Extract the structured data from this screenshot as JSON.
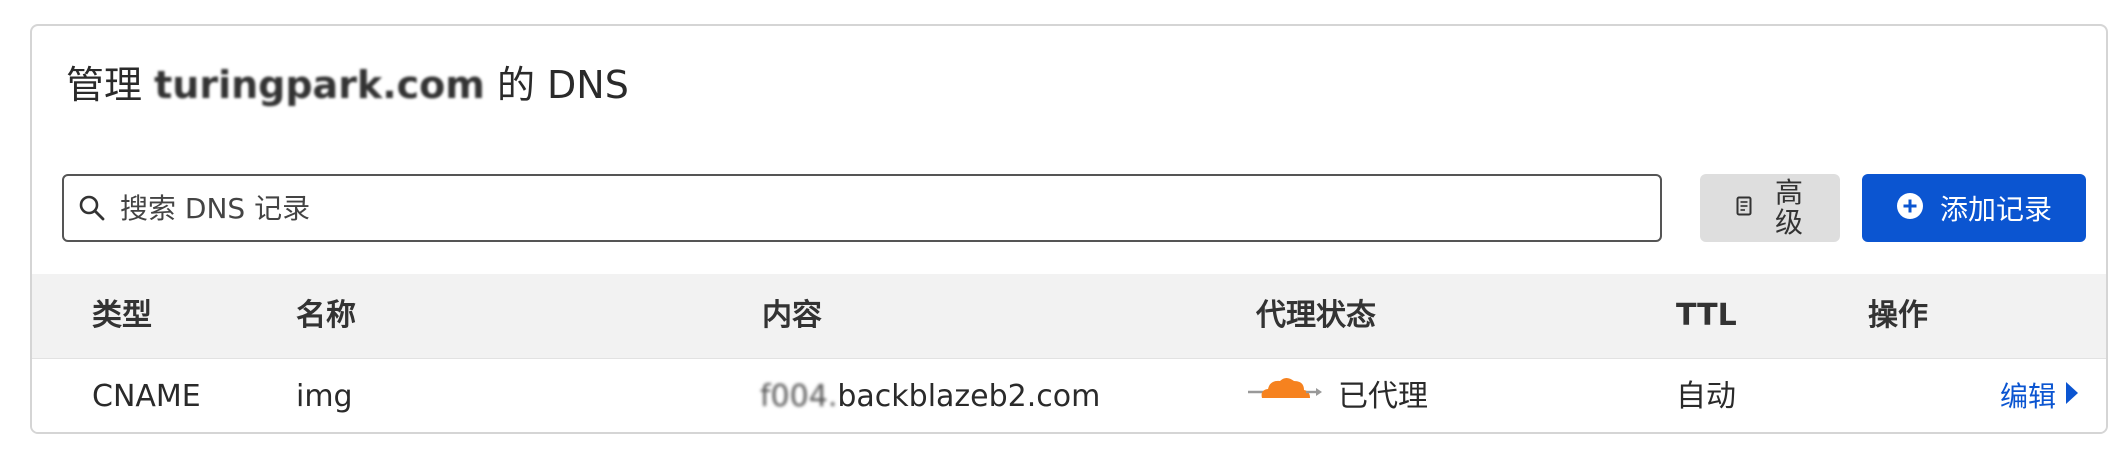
{
  "header": {
    "title_prefix": "管理",
    "domain": "turingpark.com",
    "title_suffix": "的 DNS"
  },
  "search": {
    "placeholder": "搜索 DNS 记录",
    "icon": "search-icon"
  },
  "buttons": {
    "advanced_label": "高级",
    "advanced_icon": "document-icon",
    "add_label": "添加记录",
    "add_icon": "plus-circle-icon"
  },
  "table": {
    "columns": [
      "类型",
      "名称",
      "内容",
      "代理状态",
      "TTL",
      "操作"
    ],
    "rows": [
      {
        "type": "CNAME",
        "name": "img",
        "content_hidden": "f004.",
        "content": "backblazeb2.com",
        "proxy_status": "已代理",
        "proxy_icon": "cloud-proxied-icon",
        "ttl": "自动",
        "action": "编辑"
      }
    ]
  },
  "colors": {
    "accent": "#0b55d1",
    "cloud": "#f6821f",
    "header_bg": "#f2f2f2"
  }
}
